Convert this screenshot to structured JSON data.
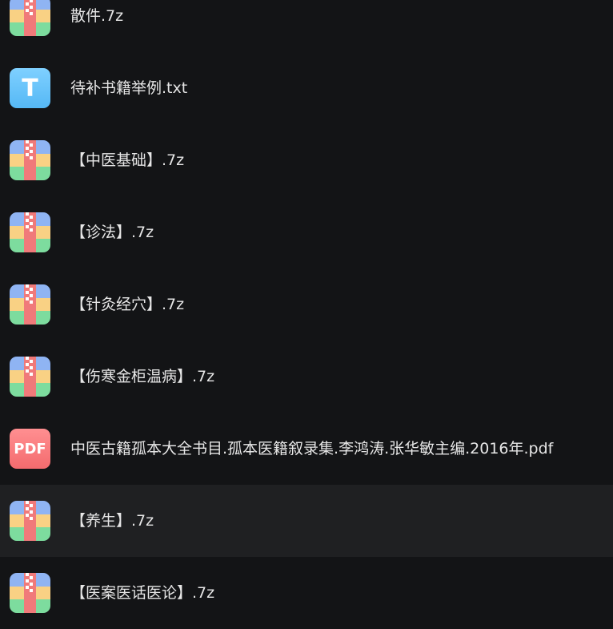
{
  "file_list": {
    "items": [
      {
        "name": "散件.7z",
        "type": "archive",
        "icon": "archive-7z-icon"
      },
      {
        "name": "待补书籍举例.txt",
        "type": "text",
        "icon": "text-file-icon",
        "icon_letter": "T"
      },
      {
        "name": "【中医基础】.7z",
        "type": "archive",
        "icon": "archive-7z-icon"
      },
      {
        "name": "【诊法】.7z",
        "type": "archive",
        "icon": "archive-7z-icon"
      },
      {
        "name": "【针灸经穴】.7z",
        "type": "archive",
        "icon": "archive-7z-icon"
      },
      {
        "name": "【伤寒金柜温病】.7z",
        "type": "archive",
        "icon": "archive-7z-icon"
      },
      {
        "name": "中医古籍孤本大全书目.孤本医籍叙录集.李鸿涛.张华敏主编.2016年.pdf",
        "type": "pdf",
        "icon": "pdf-file-icon",
        "icon_letter": "PDF"
      },
      {
        "name": "【养生】.7z",
        "type": "archive",
        "icon": "archive-7z-icon",
        "hovered": true
      },
      {
        "name": "【医案医话医论】.7z",
        "type": "archive",
        "icon": "archive-7z-icon"
      }
    ]
  },
  "colors": {
    "background": "#131416",
    "row_hover": "#1f2022",
    "text": "#e6e6e6",
    "archive_blue": "#8fb4f3",
    "archive_yellow": "#f9d184",
    "archive_green": "#7ddc9e",
    "archive_zip_red": "#f07a7a",
    "text_icon_blue": "#5bbcf7",
    "pdf_icon_red": "#f5777a"
  }
}
